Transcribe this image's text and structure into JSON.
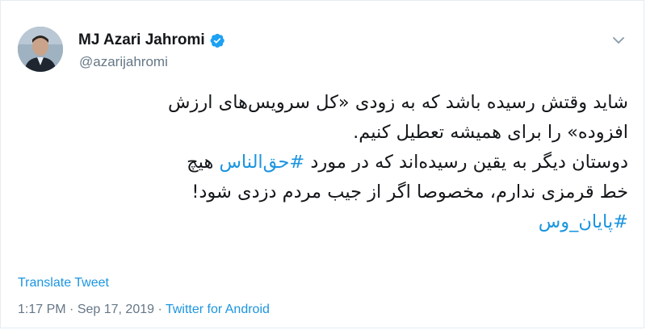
{
  "user": {
    "display_name": "MJ Azari Jahromi",
    "handle": "@azarijahromi"
  },
  "tweet": {
    "line1": "شاید وقتش رسیده باشد که به زودی «کل سرویس‌های ارزش",
    "line2": "افزوده» را برای همیشه تعطیل کنیم.",
    "line3_before": "دوستان دیگر به یقین رسیده‌اند که در مورد ",
    "line3_hashtag": "#حق‌الناس",
    "line3_after": " هیچ",
    "line4": "خط قرمزی ندارم، مخصوصا اگر از جیب مردم دزدی شود!",
    "hashtag_end": "#پایان_وس"
  },
  "translate_label": "Translate Tweet",
  "meta": {
    "time": "1:17 PM",
    "separator": " · ",
    "date": "Sep 17, 2019",
    "source": "Twitter for Android"
  },
  "icons": {
    "verified": "verified-badge-icon",
    "caret": "chevron-down-icon"
  },
  "colors": {
    "accent": "#1b95e0",
    "text": "#14171a",
    "secondary": "#657786"
  }
}
